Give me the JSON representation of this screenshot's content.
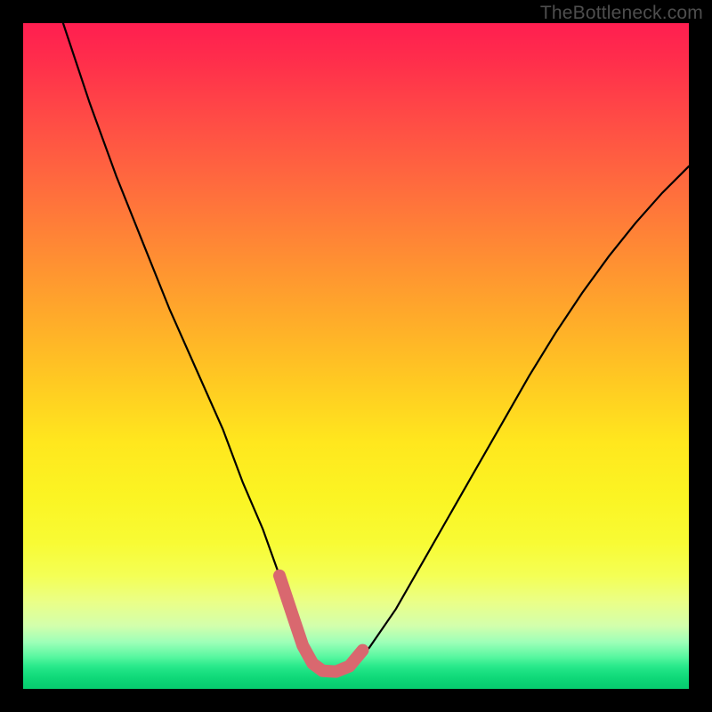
{
  "watermark": "TheBottleneck.com",
  "colors": {
    "background": "#000000",
    "curve_stroke": "#000000",
    "marker_stroke": "#d9686f",
    "gradient_top": "#ff1e50",
    "gradient_bottom": "#07cc6f"
  },
  "chart_data": {
    "type": "line",
    "title": "",
    "xlabel": "",
    "ylabel": "",
    "xlim": [
      0,
      100
    ],
    "ylim": [
      0,
      100
    ],
    "series": [
      {
        "name": "bottleneck-curve",
        "x": [
          6,
          10,
          14,
          18,
          22,
          26,
          30,
          33,
          36,
          38.5,
          40.5,
          42,
          43.5,
          45,
          47,
          49,
          52,
          56,
          60,
          64,
          68,
          72,
          76,
          80,
          84,
          88,
          92,
          96,
          100
        ],
        "y": [
          100,
          88,
          77,
          67,
          57,
          48,
          39,
          31,
          24,
          17,
          11,
          6.5,
          3.8,
          2.7,
          2.6,
          3.4,
          6.2,
          12,
          19,
          26,
          33,
          40,
          47,
          53.5,
          59.5,
          65,
          70,
          74.5,
          78.5
        ]
      },
      {
        "name": "marker-segment",
        "x": [
          38.5,
          40.5,
          42,
          43.5,
          45,
          47,
          49,
          51
        ],
        "y": [
          17,
          11,
          6.5,
          3.8,
          2.7,
          2.6,
          3.4,
          5.8
        ]
      }
    ]
  }
}
